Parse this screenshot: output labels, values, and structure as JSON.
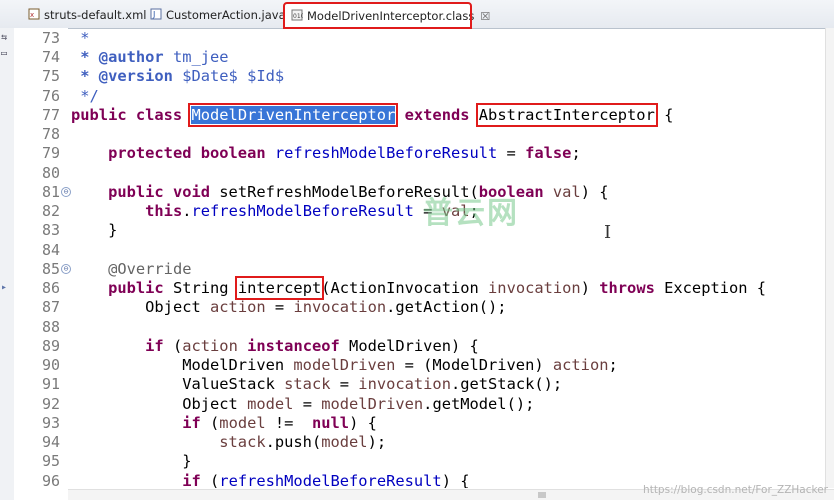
{
  "tabs": [
    {
      "label": "struts-default.xml",
      "icon": "xml-file-icon",
      "active": false
    },
    {
      "label": "CustomerAction.java",
      "icon": "java-file-icon",
      "active": false
    },
    {
      "label": "ModelDrivenInterceptor.class",
      "icon": "class-file-icon",
      "active": true,
      "close": "☒"
    }
  ],
  "editor": {
    "line_numbers": [
      "73",
      "74",
      "75",
      "76",
      "77",
      "78",
      "79",
      "80",
      "81",
      "82",
      "83",
      "84",
      "85",
      "86",
      "87",
      "88",
      "89",
      "90",
      "91",
      "92",
      "93",
      "94",
      "95",
      "96"
    ],
    "fold_markers": [
      "⊖",
      "⊖"
    ],
    "lines": {
      "l73": " *",
      "l74a": " * @author",
      "l74b": " tm_jee",
      "l75a": " * @version",
      "l75b": " $Date$ $Id$",
      "l76": " */",
      "l77_kw": "public class",
      "l77_cls": "ModelDrivenInterceptor",
      "l77_ext": "extends",
      "l77_super": "AbstractInterceptor",
      "l77_brace": " {",
      "l79_kw": "protected boolean",
      "l79_fld": "refreshModelBeforeResult",
      "l79_eq": " = ",
      "l79_false": "false",
      "l79_end": ";",
      "l81_kw": "public void",
      "l81_name": " setRefreshModelBeforeResult(",
      "l81_kw2": "boolean",
      "l81_var": " val",
      "l81_end": ") {",
      "l82_kw": "this",
      "l82_dot": ".",
      "l82_fld": "refreshModelBeforeResult",
      "l82_eq": " = ",
      "l82_var": "val",
      "l82_end": ";",
      "l83": "}",
      "l85": "@Override",
      "l86_kw": "public",
      "l86_type": " String ",
      "l86_name": "intercept",
      "l86_open": "(ActionInvocation ",
      "l86_var": "invocation",
      "l86_close": ") ",
      "l86_throws": "throws",
      "l86_exc": " Exception {",
      "l87_type": "Object ",
      "l87_var": "action",
      "l87_eq": " = ",
      "l87_var2": "invocation",
      "l87_call": ".getAction();",
      "l89_if": "if",
      "l89_open": " (",
      "l89_var": "action",
      "l89_inst": " instanceof",
      "l89_end": " ModelDriven) {",
      "l90_type": "ModelDriven ",
      "l90_var": "modelDriven",
      "l90_eq": " = (ModelDriven) ",
      "l90_var2": "action",
      "l90_end": ";",
      "l91_type": "ValueStack ",
      "l91_var": "stack",
      "l91_eq": " = ",
      "l91_var2": "invocation",
      "l91_end": ".getStack();",
      "l92_type": "Object ",
      "l92_var": "model",
      "l92_eq": " = ",
      "l92_var2": "modelDriven",
      "l92_end": ".getModel();",
      "l93_if": "if",
      "l93_open": " (",
      "l93_var": "model",
      "l93_neq": " !=  ",
      "l93_null": "null",
      "l93_end": ") {",
      "l94_var": "stack",
      "l94_end": ".push(",
      "l94_var2": "model",
      "l94_close": ");",
      "l95": "}",
      "l96_if": "if",
      "l96_open": " (",
      "l96_fld": "refreshModelBeforeResult",
      "l96_end": ") {"
    }
  },
  "watermark": "普云网",
  "credit": "https://blog.csdn.net/For_ZZHacker",
  "colors": {
    "keyword": "#7f0055",
    "comment": "#3f5fbf",
    "field": "#0000c0",
    "variable": "#6a3e3e",
    "selection": "#3875d7",
    "highlight_box": "#e01b1b"
  }
}
